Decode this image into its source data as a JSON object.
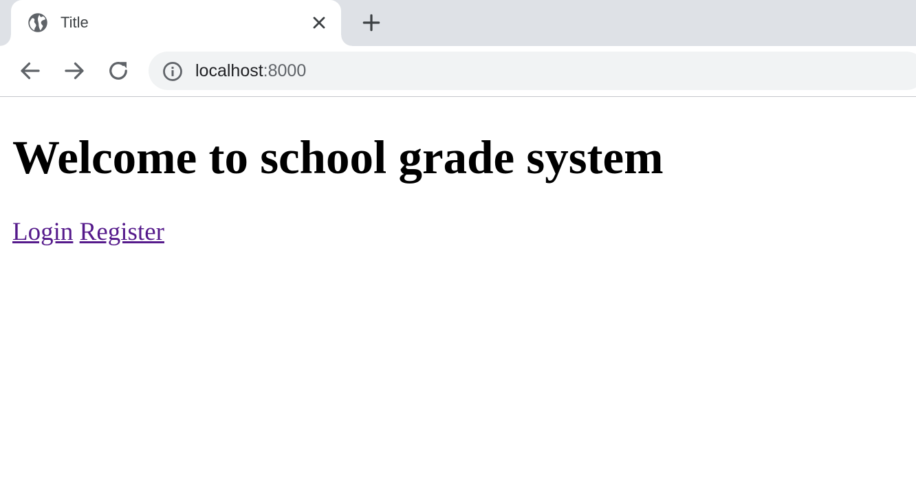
{
  "browser": {
    "tab": {
      "title": "Title",
      "favicon": "globe-icon",
      "close_icon": "close-icon"
    },
    "new_tab_icon": "plus-icon",
    "toolbar": {
      "back_icon": "back-arrow-icon",
      "forward_icon": "forward-arrow-icon",
      "reload_icon": "reload-icon"
    },
    "address_bar": {
      "security_icon": "info-icon",
      "host": "localhost",
      "port": ":8000"
    },
    "colors": {
      "tabstrip": "#dee1e6",
      "omnibox": "#f1f3f4",
      "icon": "#5f6368",
      "visited_link": "#551a8b"
    }
  },
  "page": {
    "heading": "Welcome to school grade system",
    "links": {
      "login": "Login",
      "register": "Register"
    }
  }
}
